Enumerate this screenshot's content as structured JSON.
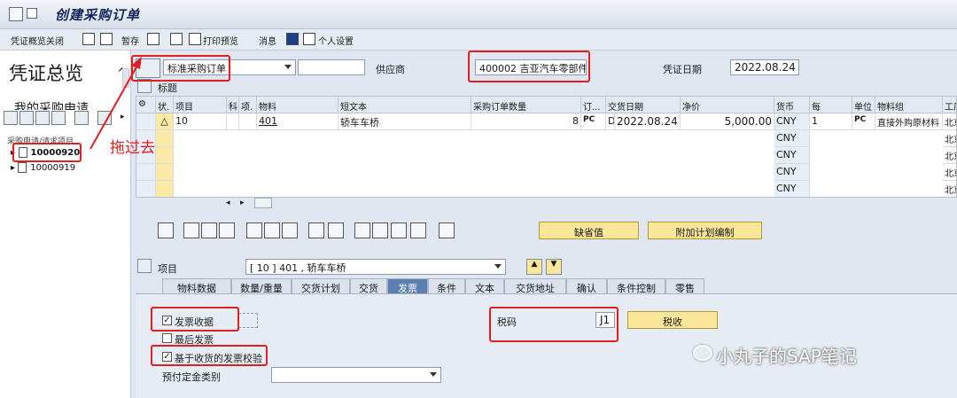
{
  "window": {
    "title": "创建采购订单"
  },
  "toolbar": {
    "doc_overview_off": "凭证概览关闭",
    "hold": "暂存",
    "print_preview": "打印预览",
    "messages": "消息",
    "personal_settings": "个人设置"
  },
  "left": {
    "title": "凭证总览",
    "my_pr": "我的采购申请",
    "column": "采购申请/请求项目",
    "items": [
      "10000920",
      "10000919"
    ]
  },
  "header": {
    "order_type": "标准采购订单",
    "vendor_label": "供应商",
    "vendor_value": "400002 吉亚汽车零部件",
    "doc_date_label": "凭证日期",
    "doc_date_value": "2022.08.24",
    "header_label": "标题"
  },
  "table": {
    "columns": [
      "状.",
      "项目",
      "科",
      "项.",
      "物料",
      "短文本",
      "采购订单数量",
      "订...",
      "交货日期",
      "净价",
      "货币",
      "每",
      "单位",
      "物料组",
      "工厂"
    ],
    "rows": [
      {
        "status": "△",
        "item": "10",
        "material": "401",
        "short_text": "轿车车桥",
        "qty": "8",
        "uom": "PC",
        "date_cat": "D",
        "delivery_date": "2022.08.24",
        "net_price": "5,000.00",
        "currency": "CNY",
        "per": "1",
        "unit": "PC",
        "mat_group": "直接外购原材料",
        "plant": "北京"
      },
      {
        "currency": "CNY",
        "plant": "北京"
      },
      {
        "currency": "CNY",
        "plant": "北京"
      },
      {
        "currency": "CNY",
        "plant": "北京"
      },
      {
        "currency": "CNY",
        "plant": "北京"
      }
    ]
  },
  "buttons": {
    "default_values": "缺省值",
    "additional_planning": "附加计划编制",
    "tax": "税收"
  },
  "item_detail": {
    "label": "项目",
    "selected": "[ 10 ] 401 , 轿车车桥",
    "tabs": [
      "物料数据",
      "数量/重量",
      "交货计划",
      "交货",
      "发票",
      "条件",
      "文本",
      "交货地址",
      "确认",
      "条件控制",
      "零售"
    ],
    "active_tab": "发票",
    "inv_receipt": "发票收据",
    "final_invoice": "最后发票",
    "gr_based_iv": "基于收货的发票校验",
    "dp_category": "预付定金类别",
    "tax_code_label": "税码",
    "tax_code_value": "J1"
  },
  "annotation": {
    "drag_text": "拖过去"
  },
  "watermark": {
    "text": "小丸子的SAP笔记"
  },
  "colors": {
    "accent_red": "#e02020",
    "sap_yellow": "#fbe79a",
    "active_tab": "#5a7fb0"
  }
}
